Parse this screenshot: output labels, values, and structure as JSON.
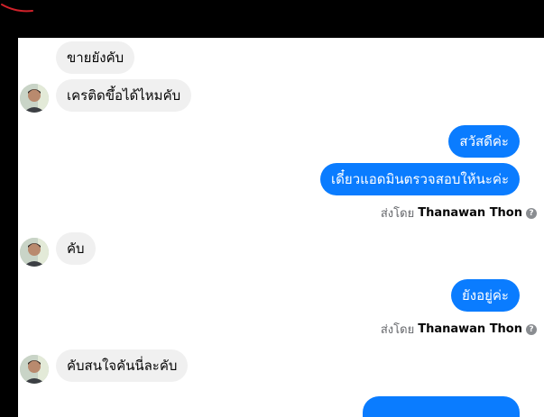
{
  "conversation": {
    "messages": [
      {
        "direction": "incoming",
        "text": "ขายยังคับ"
      },
      {
        "direction": "incoming",
        "text": "เครติดขึ้อได้ไหมคับ"
      },
      {
        "direction": "outgoing",
        "text": "สวัสดีค่ะ"
      },
      {
        "direction": "outgoing",
        "text": "เดี๋ยวแอดมินตรวจสอบให้นะค่ะ"
      },
      {
        "direction": "incoming",
        "text": "คับ"
      },
      {
        "direction": "outgoing",
        "text": "ยังอยู่ค่ะ"
      },
      {
        "direction": "incoming",
        "text": "คับสนใจคันนี่ละคับ"
      }
    ],
    "sent_by": {
      "prefix": "ส่งโดย",
      "name": "Thanawan Thon"
    }
  },
  "colors": {
    "outgoing_bubble": "#0a7cff",
    "incoming_bubble": "#f0f0f0",
    "background": "#ffffff",
    "frame": "#000000",
    "annotation_stroke": "#d0212a"
  },
  "icons": {
    "help": "question-circle-icon",
    "avatar": "user-avatar-photo"
  }
}
